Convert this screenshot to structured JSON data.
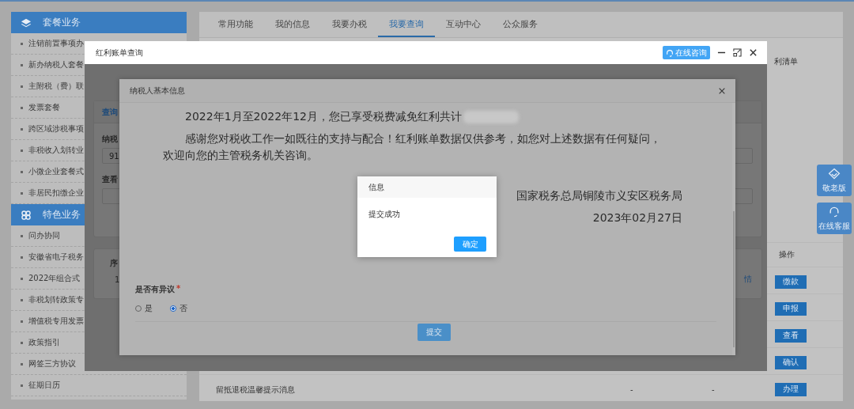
{
  "sidebar": {
    "sections": [
      {
        "title": "套餐业务",
        "kind": "layers",
        "items": [
          "注销前置事项办",
          "新办纳税人套餐",
          "主附税（费）联",
          "发票套餐",
          "跨区域涉税事项",
          "非税收入划转业",
          "小微企业套餐式",
          "非居民扣缴企业"
        ]
      },
      {
        "title": "特色业务",
        "kind": "clover",
        "items": [
          "问办协同",
          "安徽省电子税务",
          "2022年组合式",
          "非税划转政策专",
          "增值税专用发票",
          "政策指引",
          "网签三方协议",
          "征期日历"
        ]
      }
    ]
  },
  "tabs": [
    {
      "label": "常用功能",
      "selected": false
    },
    {
      "label": "我的信息",
      "selected": false
    },
    {
      "label": "我要办税",
      "selected": false
    },
    {
      "label": "我要查询",
      "selected": true
    },
    {
      "label": "互动中心",
      "selected": false
    },
    {
      "label": "公众服务",
      "selected": false
    }
  ],
  "content": {
    "heading_fragment": "利清单",
    "table": {
      "columns": [
        "操作"
      ],
      "rows": [
        {
          "action": "缴款"
        },
        {
          "action": "申报"
        },
        {
          "action": "查看"
        },
        {
          "action": "确认"
        },
        {
          "name": "留抵退税温馨提示消息",
          "column_2": "-",
          "column_3": "-",
          "action": "办理"
        }
      ]
    }
  },
  "float_buttons": [
    {
      "label": "敬老版",
      "kind": "elder"
    },
    {
      "label": "在线客服",
      "kind": "service"
    }
  ],
  "bill_window": {
    "title": "红利账单查询",
    "consult_button": "在线咨询",
    "query_tab": "查询",
    "taxpayer_label": "纳税",
    "taxpayer_field": "91",
    "view_label": "查看",
    "index_header": "序",
    "index_value": "1",
    "detail_link": "情"
  },
  "taxpayer_dialog": {
    "title": "纳税人基本信息",
    "summary": "2022年1月至2022年12月，您已享受税费减免红利共计",
    "thanks": "感谢您对税收工作一如既往的支持与配合！红利账单数据仅供参考，如您对上述数据有任何疑问，欢迎向您的主管税务机关咨询。",
    "signature": "国家税务总局铜陵市义安区税务局",
    "date": "2023年02月27日",
    "question": "是否有异议",
    "required_mark": "*",
    "options": [
      {
        "label": "是",
        "selected": false
      },
      {
        "label": "否",
        "selected": true
      }
    ],
    "submit_button": "提交"
  },
  "info_dialog": {
    "title": "信息",
    "message": "提交成功",
    "ok_button": "确定"
  }
}
